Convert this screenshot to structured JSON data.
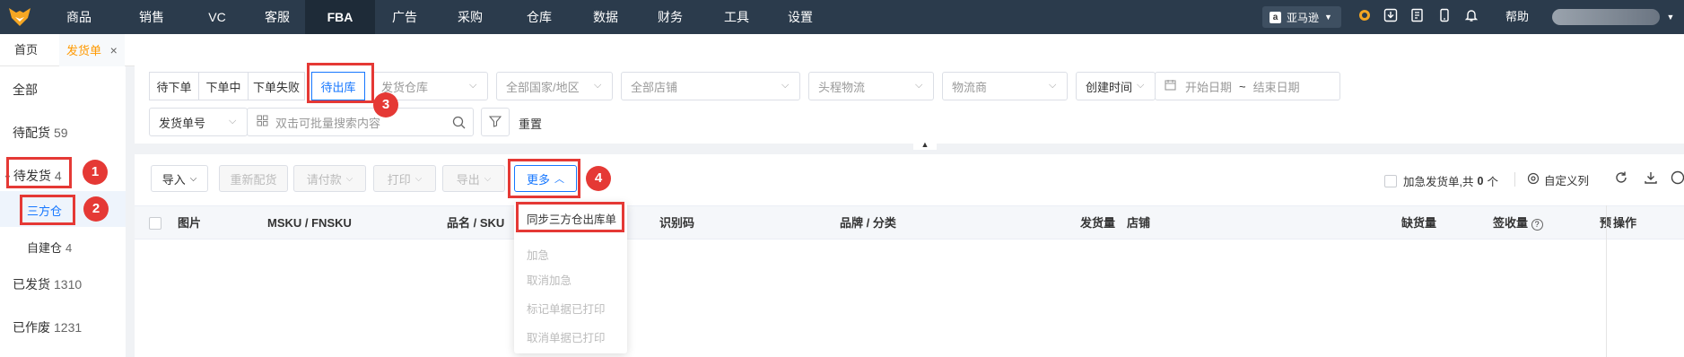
{
  "nav": {
    "items": [
      "商品",
      "销售",
      "VC",
      "客服",
      "FBA",
      "广告",
      "采购",
      "仓库",
      "数据",
      "财务",
      "工具",
      "设置"
    ],
    "active": "FBA",
    "marketplace": "亚马逊",
    "help": "帮助"
  },
  "tabs": {
    "home": "首页",
    "current": "发货单"
  },
  "sidebar": {
    "all": "全部",
    "pending_alloc": {
      "label": "待配货",
      "count": "59"
    },
    "pending_ship": {
      "label": "待发货",
      "count": "4"
    },
    "third_party": {
      "label": "三方仓",
      "count": ""
    },
    "self_built": {
      "label": "自建仓",
      "count": "4"
    },
    "shipped": {
      "label": "已发货",
      "count": "1310"
    },
    "voided": {
      "label": "已作废",
      "count": "1231"
    }
  },
  "filters": {
    "status_tabs": [
      "待下单",
      "下单中",
      "下单失败",
      "待出库"
    ],
    "active_status": "待出库",
    "warehouse_placeholder": "发货仓库",
    "country_placeholder": "全部国家/地区",
    "store_placeholder": "全部店铺",
    "logistics_placeholder": "头程物流",
    "carrier_placeholder": "物流商",
    "time_type": "创建时间",
    "start_date": "开始日期",
    "date_sep": "~",
    "end_date": "结束日期",
    "search_field": "发货单号",
    "search_placeholder": "双击可批量搜索内容",
    "reset": "重置"
  },
  "toolbar": {
    "import": "导入",
    "realloc": "重新配货",
    "request_payment": "请付款",
    "print": "打印",
    "export": "导出",
    "more": "更多",
    "urgent_label": "加急发货单,共",
    "urgent_count": "0",
    "urgent_unit": "个",
    "custom_columns": "自定义列"
  },
  "table": {
    "columns": [
      "图片",
      "MSKU / FNSKU",
      "品名 / SKU",
      "识别码",
      "品牌 / 分类",
      "发货量",
      "店铺",
      "缺货量",
      "签收量",
      "操作"
    ],
    "truncated_col": "预"
  },
  "more_menu": {
    "items": [
      "同步三方仓出库单",
      "加急",
      "取消加急",
      "标记单据已打印",
      "取消单据已打印"
    ]
  },
  "annotations": [
    "1",
    "2",
    "3",
    "4"
  ],
  "colors": {
    "accent": "#1677ff",
    "highlight": "#e53935",
    "nav_bg": "#2b3b4c",
    "brand": "#f90"
  }
}
